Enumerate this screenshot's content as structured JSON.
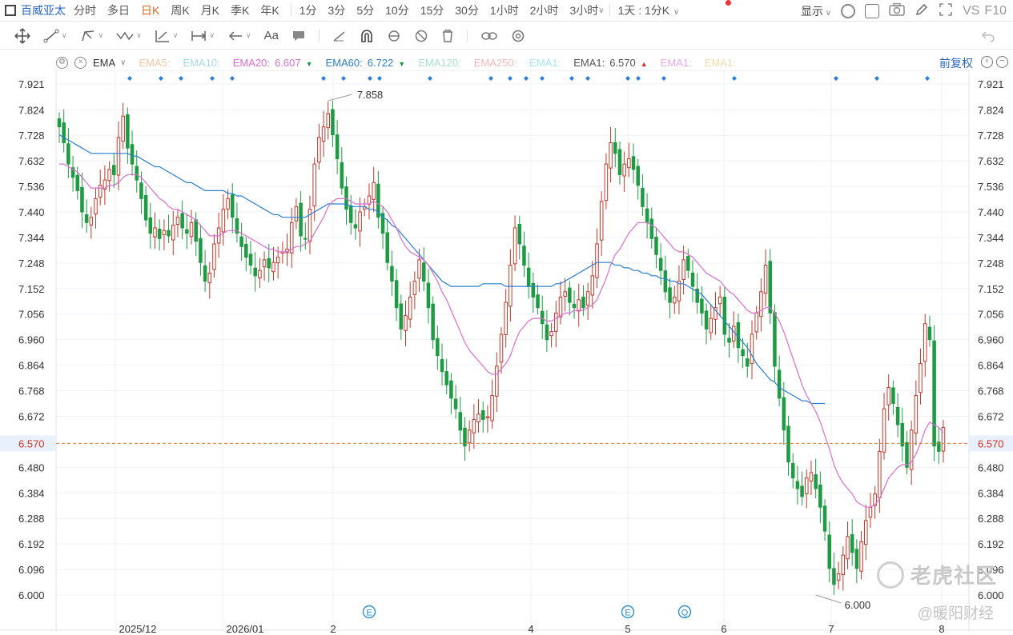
{
  "toolbar": {
    "stock_name": "百威亚太",
    "periods": [
      {
        "label": "分时",
        "active": false
      },
      {
        "label": "多日",
        "active": false
      },
      {
        "label": "日K",
        "active": true
      },
      {
        "label": "周K",
        "active": false
      },
      {
        "label": "月K",
        "active": false
      },
      {
        "label": "季K",
        "active": false
      },
      {
        "label": "年K",
        "active": false
      },
      {
        "label": "1分",
        "active": false
      },
      {
        "label": "3分",
        "active": false
      },
      {
        "label": "5分",
        "active": false
      },
      {
        "label": "10分",
        "active": false
      },
      {
        "label": "15分",
        "active": false
      },
      {
        "label": "30分",
        "active": false
      },
      {
        "label": "1小时",
        "active": false
      },
      {
        "label": "2小时",
        "active": false
      },
      {
        "label": "3小时",
        "active": false
      }
    ],
    "special_period": "1天 : 1分K",
    "display_label": "显示",
    "vs_label": "VS",
    "f10_label": "F10"
  },
  "draw_tools": [
    "move-icon",
    "line-icon",
    "path-icon",
    "wave-icon",
    "measure-icon",
    "range-icon",
    "arrow-icon"
  ],
  "draw_text": "Aa",
  "legend": {
    "indicator": "EMA",
    "items": [
      {
        "label": "EMA5:",
        "value": "",
        "color": "#f4c5a6",
        "arrow": ""
      },
      {
        "label": "EMA10:",
        "value": "",
        "color": "#a8d8f0",
        "arrow": ""
      },
      {
        "label": "EMA20:",
        "value": "6.607",
        "color": "#d86fcf",
        "arrow": "down"
      },
      {
        "label": "EMA60:",
        "value": "6.722",
        "color": "#2b7fd4",
        "arrow": "down"
      },
      {
        "label": "EMA120:",
        "value": "",
        "color": "#a8e0d0",
        "arrow": ""
      },
      {
        "label": "EMA250:",
        "value": "",
        "color": "#f7b7b7",
        "arrow": ""
      },
      {
        "label": "EMA1:",
        "value": "",
        "color": "#a8e4f5",
        "arrow": ""
      },
      {
        "label": "EMA1:",
        "value": "6.570",
        "color": "#555555",
        "arrow": "up"
      },
      {
        "label": "EMA1:",
        "value": "",
        "color": "#e6a9ea",
        "arrow": ""
      },
      {
        "label": "EMA1:",
        "value": "",
        "color": "#f5d9a8",
        "arrow": ""
      }
    ],
    "adjust_label": "前复权"
  },
  "colors": {
    "up": "#c0392b",
    "down": "#1e9b43",
    "ema20": "#d86fcf",
    "ema60": "#2b7fd4",
    "current_line": "#e07b4a",
    "current_label_bg": "#e8f0fb",
    "current_label_text": "#d2331f",
    "marker": "#2b7fd4"
  },
  "chart_data": {
    "type": "candlestick",
    "y_ticks": [
      "7.921",
      "7.824",
      "7.728",
      "7.632",
      "7.536",
      "7.440",
      "7.344",
      "7.248",
      "7.152",
      "7.056",
      "6.960",
      "6.864",
      "6.768",
      "6.672",
      "6.570",
      "6.480",
      "6.384",
      "6.288",
      "6.192",
      "6.096",
      "6.000"
    ],
    "ylim": [
      6.0,
      7.921
    ],
    "current_price": 6.57,
    "x_labels": [
      "2025/12",
      "2026/01",
      "2",
      "4",
      "5",
      "6",
      "7",
      "8"
    ],
    "annotations": [
      {
        "text": "7.858",
        "kind": "high"
      },
      {
        "text": "6.000",
        "kind": "low"
      }
    ],
    "event_badges": [
      "E",
      "E",
      "Q"
    ],
    "close": [
      7.76,
      7.7,
      7.62,
      7.57,
      7.52,
      7.44,
      7.4,
      7.42,
      7.49,
      7.54,
      7.56,
      7.6,
      7.58,
      7.72,
      7.8,
      7.68,
      7.62,
      7.56,
      7.49,
      7.41,
      7.36,
      7.38,
      7.34,
      7.37,
      7.35,
      7.39,
      7.42,
      7.38,
      7.36,
      7.4,
      7.33,
      7.25,
      7.18,
      7.21,
      7.32,
      7.38,
      7.45,
      7.49,
      7.42,
      7.36,
      7.31,
      7.27,
      7.24,
      7.2,
      7.22,
      7.26,
      7.23,
      7.25,
      7.27,
      7.29,
      7.3,
      7.4,
      7.46,
      7.35,
      7.34,
      7.45,
      7.62,
      7.72,
      7.76,
      7.81,
      7.73,
      7.64,
      7.53,
      7.45,
      7.4,
      7.38,
      7.44,
      7.46,
      7.5,
      7.55,
      7.42,
      7.36,
      7.25,
      7.18,
      7.08,
      7.0,
      7.05,
      7.12,
      7.18,
      7.26,
      7.18,
      7.08,
      6.96,
      6.9,
      6.84,
      6.79,
      6.74,
      6.7,
      6.62,
      6.56,
      6.62,
      6.66,
      6.68,
      6.66,
      6.67,
      6.75,
      6.86,
      6.98,
      7.1,
      7.24,
      7.38,
      7.32,
      7.24,
      7.16,
      7.12,
      7.08,
      7.02,
      6.96,
      6.99,
      7.06,
      7.12,
      7.14,
      7.1,
      7.08,
      7.11,
      7.08,
      7.14,
      7.2,
      7.32,
      7.48,
      7.62,
      7.7,
      7.66,
      7.58,
      7.62,
      7.64,
      7.6,
      7.54,
      7.46,
      7.4,
      7.34,
      7.28,
      7.22,
      7.14,
      7.1,
      7.12,
      7.18,
      7.26,
      7.22,
      7.16,
      7.1,
      7.06,
      7.0,
      7.04,
      7.08,
      7.12,
      6.98,
      6.95,
      7.01,
      6.93,
      6.9,
      6.86,
      6.98,
      7.06,
      7.14,
      7.24,
      7.06,
      6.86,
      6.74,
      6.62,
      6.5,
      6.44,
      6.4,
      6.37,
      6.44,
      6.46,
      6.4,
      6.33,
      6.24,
      6.1,
      6.04,
      6.08,
      6.15,
      6.22,
      6.16,
      6.1,
      6.2,
      6.28,
      6.33,
      6.38,
      6.54,
      6.7,
      6.78,
      6.72,
      6.64,
      6.56,
      6.48,
      6.62,
      6.75,
      6.87,
      7.02,
      6.96,
      6.56,
      6.54,
      6.63
    ],
    "ema20": [
      7.62,
      7.62,
      7.61,
      7.6,
      7.59,
      7.57,
      7.55,
      7.53,
      7.53,
      7.53,
      7.53,
      7.54,
      7.54,
      7.55,
      7.57,
      7.58,
      7.58,
      7.58,
      7.57,
      7.55,
      7.53,
      7.51,
      7.49,
      7.48,
      7.46,
      7.45,
      7.45,
      7.44,
      7.43,
      7.42,
      7.41,
      7.39,
      7.37,
      7.35,
      7.35,
      7.35,
      7.36,
      7.37,
      7.37,
      7.37,
      7.36,
      7.35,
      7.34,
      7.33,
      7.32,
      7.31,
      7.3,
      7.3,
      7.29,
      7.29,
      7.29,
      7.3,
      7.31,
      7.31,
      7.32,
      7.33,
      7.36,
      7.39,
      7.42,
      7.46,
      7.48,
      7.49,
      7.49,
      7.49,
      7.48,
      7.47,
      7.47,
      7.47,
      7.47,
      7.48,
      7.47,
      7.46,
      7.44,
      7.41,
      7.38,
      7.34,
      7.31,
      7.29,
      7.28,
      7.27,
      7.26,
      7.24,
      7.21,
      7.18,
      7.14,
      7.11,
      7.07,
      7.03,
      6.99,
      6.95,
      6.92,
      6.9,
      6.88,
      6.86,
      6.84,
      6.83,
      6.83,
      6.85,
      6.87,
      6.9,
      6.95,
      6.99,
      7.01,
      7.03,
      7.04,
      7.04,
      7.04,
      7.03,
      7.03,
      7.04,
      7.05,
      7.06,
      7.06,
      7.07,
      7.07,
      7.07,
      7.08,
      7.09,
      7.11,
      7.15,
      7.19,
      7.24,
      7.28,
      7.3,
      7.33,
      7.36,
      7.38,
      7.4,
      7.4,
      7.4,
      7.39,
      7.38,
      7.36,
      7.34,
      7.32,
      7.3,
      7.29,
      7.29,
      7.28,
      7.27,
      7.25,
      7.23,
      7.21,
      7.2,
      7.19,
      7.18,
      7.16,
      7.14,
      7.13,
      7.11,
      7.09,
      7.07,
      7.06,
      7.06,
      7.07,
      7.08,
      7.08,
      7.06,
      7.03,
      6.99,
      6.94,
      6.89,
      6.84,
      6.79,
      6.75,
      6.72,
      6.69,
      6.65,
      6.6,
      6.55,
      6.49,
      6.45,
      6.42,
      6.4,
      6.38,
      6.35,
      6.34,
      6.33,
      6.33,
      6.34,
      6.36,
      6.4,
      6.44,
      6.46,
      6.48,
      6.49,
      6.49,
      6.5,
      6.53,
      6.57,
      6.62,
      6.65,
      6.64,
      6.63,
      6.61
    ],
    "ema60": [
      7.73,
      7.72,
      7.71,
      7.7,
      7.69,
      7.68,
      7.67,
      7.66,
      7.66,
      7.66,
      7.66,
      7.66,
      7.66,
      7.66,
      7.66,
      7.66,
      7.65,
      7.65,
      7.64,
      7.63,
      7.62,
      7.61,
      7.61,
      7.6,
      7.59,
      7.58,
      7.57,
      7.56,
      7.55,
      7.55,
      7.54,
      7.53,
      7.52,
      7.52,
      7.52,
      7.52,
      7.52,
      7.51,
      7.51,
      7.5,
      7.5,
      7.49,
      7.48,
      7.47,
      7.46,
      7.45,
      7.44,
      7.43,
      7.43,
      7.42,
      7.42,
      7.42,
      7.42,
      7.42,
      7.42,
      7.43,
      7.44,
      7.45,
      7.46,
      7.47,
      7.47,
      7.47,
      7.47,
      7.47,
      7.46,
      7.46,
      7.46,
      7.46,
      7.45,
      7.45,
      7.44,
      7.42,
      7.41,
      7.39,
      7.38,
      7.36,
      7.34,
      7.32,
      7.3,
      7.28,
      7.26,
      7.24,
      7.22,
      7.2,
      7.18,
      7.17,
      7.16,
      7.16,
      7.16,
      7.16,
      7.16,
      7.16,
      7.16,
      7.17,
      7.17,
      7.17,
      7.17,
      7.17,
      7.16,
      7.16,
      7.16,
      7.16,
      7.16,
      7.16,
      7.16,
      7.16,
      7.16,
      7.16,
      7.16,
      7.17,
      7.17,
      7.18,
      7.19,
      7.2,
      7.21,
      7.22,
      7.23,
      7.24,
      7.25,
      7.25,
      7.25,
      7.25,
      7.24,
      7.24,
      7.23,
      7.23,
      7.22,
      7.22,
      7.21,
      7.21,
      7.2,
      7.2,
      7.19,
      7.19,
      7.18,
      7.18,
      7.17,
      7.17,
      7.16,
      7.15,
      7.14,
      7.13,
      7.11,
      7.09,
      7.07,
      7.05,
      7.03,
      7.01,
      6.99,
      6.97,
      6.95,
      6.93,
      6.9,
      6.87,
      6.85,
      6.83,
      6.81,
      6.8,
      6.78,
      6.77,
      6.76,
      6.75,
      6.74,
      6.73,
      6.73,
      6.72,
      6.72,
      6.72,
      6.72
    ]
  }
}
